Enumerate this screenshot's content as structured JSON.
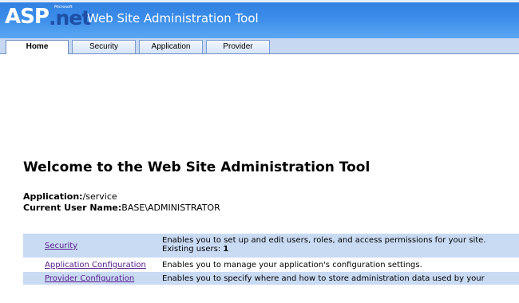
{
  "header": {
    "logo_asp": "ASP",
    "logo_net": ".net",
    "logo_microsoft": "Microsoft",
    "title": "Web Site Administration Tool"
  },
  "tabs": [
    {
      "label": "Home",
      "active": true
    },
    {
      "label": "Security",
      "active": false
    },
    {
      "label": "Application",
      "active": false
    },
    {
      "label": "Provider",
      "active": false
    }
  ],
  "main": {
    "heading": "Welcome to the Web Site Administration Tool",
    "application_label": "Application:",
    "application_value": "/service",
    "user_label": "Current User Name:",
    "user_value": "BASE\\ADMINISTRATOR"
  },
  "links": [
    {
      "label": "Security",
      "description": "Enables you to set up and edit users, roles, and access permissions for your site.",
      "extra_label": "Existing users: ",
      "extra_value": "1"
    },
    {
      "label": "Application Configuration",
      "description": "Enables you to manage your application's configuration settings."
    },
    {
      "label": "Provider Configuration",
      "description": "Enables you to specify where and how to store administration data used by your"
    }
  ],
  "colors": {
    "header_blue": "#3b8cea",
    "tab_bar": "#c6d8f2",
    "row_highlight": "#c9daf3",
    "link": "#551a8b"
  }
}
